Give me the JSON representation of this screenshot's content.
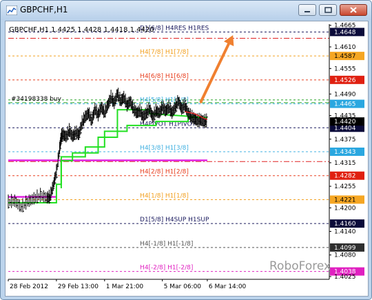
{
  "window": {
    "title": "GBPCHF,H1"
  },
  "chart_data": {
    "type": "line",
    "title": "",
    "info_text": "GBPCHF,H1  1.4425 1.4428 1.4418 1.4420",
    "symbol": "GBPCHF",
    "timeframe": "H1",
    "ohlc": {
      "open": 1.4425,
      "high": 1.4428,
      "low": 1.4418,
      "close": 1.442
    },
    "watermark": "RoboForex",
    "xlabel": "",
    "ylabel": "",
    "ylim": [
      1.4018,
      1.4668
    ],
    "y_ticks": [
      "1.4665",
      "1.4610",
      "1.4555",
      "1.4490",
      "1.4435",
      "1.4375",
      "1.4315",
      "1.4255",
      "1.4200",
      "1.4140",
      "1.4080",
      "1.4025"
    ],
    "x_ticks": [
      "28 Feb 2012",
      "29 Feb 13:00",
      "1 Mar 21:00",
      "5 Mar 06:00",
      "6 Mar 14:00"
    ],
    "current_price": 1.442,
    "levels": [
      {
        "label": "D1[6/8] H4RES H1RES",
        "price": 1.4648,
        "tag": "1.4648",
        "color": "#1a1a5e",
        "style": "dashed",
        "tag_bg": "#0b0b3a",
        "tag_fg": "#ffffff"
      },
      {
        "label": "",
        "price": 1.4632,
        "tag": "",
        "color": "#e02020",
        "style": "dashdot"
      },
      {
        "label": "H4[7/8] H1[7/8]",
        "price": 1.4587,
        "tag": "1.4587",
        "color": "#f2a020",
        "style": "dashed",
        "tag_bg": "#f5a623",
        "tag_fg": "#000000"
      },
      {
        "label": "H4[6/8] H1[6/8]",
        "price": 1.4526,
        "tag": "1.4526",
        "color": "#e84020",
        "style": "dashed",
        "tag_bg": "#e02010",
        "tag_fg": "#ffffff"
      },
      {
        "label": "",
        "price": 1.4475,
        "tag": "",
        "color": "#20a020",
        "style": "dashed"
      },
      {
        "label": "H4[5/8] H1[5/8]",
        "price": 1.4465,
        "tag": "1.4465",
        "color": "#40b0e0",
        "style": "dashed",
        "tag_bg": "#2aa7e0",
        "tag_fg": "#ffffff"
      },
      {
        "label": "H4PIVOT H1PIVOT",
        "price": 1.4404,
        "tag": "1.4404",
        "color": "#1a1a5e",
        "style": "dashed",
        "tag_bg": "#0b0b3a",
        "tag_fg": "#ffffff"
      },
      {
        "label": "H4[3/8] H1[3/8]",
        "price": 1.4343,
        "tag": "1.4343",
        "color": "#40b0e0",
        "style": "dashed",
        "tag_bg": "#2aa7e0",
        "tag_fg": "#ffffff"
      },
      {
        "label": "",
        "price": 1.4318,
        "tag": "",
        "color": "#e02020",
        "style": "dashdot"
      },
      {
        "label": "H4[2/8] H1[2/8]",
        "price": 1.4282,
        "tag": "1.4282",
        "color": "#e84020",
        "style": "dashed",
        "tag_bg": "#e02010",
        "tag_fg": "#ffffff"
      },
      {
        "label": "H4[1/8] H1[1/8]",
        "price": 1.4221,
        "tag": "1.4221",
        "color": "#f2a020",
        "style": "dashed",
        "tag_bg": "#f5a623",
        "tag_fg": "#000000"
      },
      {
        "label": "D1[5/8] H4SUP H1SUP",
        "price": 1.416,
        "tag": "1.4160",
        "color": "#1a1a5e",
        "style": "dashed",
        "tag_bg": "#0b0b3a",
        "tag_fg": "#ffffff"
      },
      {
        "label": "H4[-1/8] H1[-1/8]",
        "price": 1.4099,
        "tag": "1.4099",
        "color": "#555555",
        "style": "dashed",
        "tag_bg": "#2f2f2f",
        "tag_fg": "#ffffff"
      },
      {
        "label": "H4[-2/8] H1[-2/8]",
        "price": 1.4038,
        "tag": "1.4038",
        "color": "#e020c0",
        "style": "dashed",
        "tag_bg": "#e020c0",
        "tag_fg": "#ffffff"
      }
    ],
    "price_tags": [
      {
        "price": 1.442,
        "tag": "1.4420",
        "tag_bg": "#000000",
        "tag_fg": "#ffffff"
      }
    ],
    "order_line": {
      "label": "#34198338 buy",
      "price": 1.4468,
      "color": "#20a020"
    },
    "magenta_lines": [
      {
        "price": 1.4321,
        "x_start": 0.0,
        "x_end": 0.62
      },
      {
        "price": 1.4228,
        "x_start": 0.0,
        "x_end": 0.15
      }
    ],
    "price_path": [
      [
        0.0,
        1.4213
      ],
      [
        0.02,
        1.4216
      ],
      [
        0.04,
        1.42
      ],
      [
        0.06,
        1.4214
      ],
      [
        0.08,
        1.4222
      ],
      [
        0.1,
        1.423
      ],
      [
        0.12,
        1.4224
      ],
      [
        0.13,
        1.4226
      ],
      [
        0.14,
        1.4255
      ],
      [
        0.15,
        1.429
      ],
      [
        0.16,
        1.435
      ],
      [
        0.165,
        1.438
      ],
      [
        0.17,
        1.4385
      ],
      [
        0.18,
        1.438
      ],
      [
        0.19,
        1.4395
      ],
      [
        0.2,
        1.438
      ],
      [
        0.21,
        1.439
      ],
      [
        0.22,
        1.4385
      ],
      [
        0.23,
        1.4415
      ],
      [
        0.24,
        1.443
      ],
      [
        0.25,
        1.444
      ],
      [
        0.26,
        1.442
      ],
      [
        0.27,
        1.445
      ],
      [
        0.28,
        1.4435
      ],
      [
        0.29,
        1.4455
      ],
      [
        0.3,
        1.444
      ],
      [
        0.31,
        1.446
      ],
      [
        0.32,
        1.448
      ],
      [
        0.33,
        1.4465
      ],
      [
        0.34,
        1.449
      ],
      [
        0.35,
        1.447
      ],
      [
        0.36,
        1.448
      ],
      [
        0.37,
        1.446
      ],
      [
        0.38,
        1.447
      ],
      [
        0.39,
        1.445
      ],
      [
        0.4,
        1.444
      ],
      [
        0.41,
        1.4445
      ],
      [
        0.42,
        1.443
      ],
      [
        0.43,
        1.444
      ],
      [
        0.44,
        1.445
      ],
      [
        0.45,
        1.443
      ],
      [
        0.46,
        1.4445
      ],
      [
        0.47,
        1.444
      ],
      [
        0.48,
        1.4455
      ],
      [
        0.49,
        1.4445
      ],
      [
        0.5,
        1.4455
      ],
      [
        0.51,
        1.444
      ],
      [
        0.52,
        1.4455
      ],
      [
        0.53,
        1.447
      ],
      [
        0.54,
        1.445
      ],
      [
        0.55,
        1.446
      ],
      [
        0.56,
        1.444
      ],
      [
        0.57,
        1.443
      ],
      [
        0.58,
        1.4425
      ],
      [
        0.59,
        1.442
      ],
      [
        0.6,
        1.4422
      ],
      [
        0.61,
        1.4418
      ],
      [
        0.62,
        1.442
      ]
    ],
    "green_band": [
      [
        0.0,
        1.4213
      ],
      [
        0.15,
        1.4213
      ],
      [
        0.15,
        1.426
      ],
      [
        0.165,
        1.426
      ],
      [
        0.165,
        1.433
      ],
      [
        0.24,
        1.433
      ],
      [
        0.24,
        1.4355
      ],
      [
        0.3,
        1.4355
      ],
      [
        0.3,
        1.4395
      ],
      [
        0.37,
        1.4395
      ],
      [
        0.37,
        1.441
      ],
      [
        0.46,
        1.441
      ],
      [
        0.46,
        1.442
      ],
      [
        0.56,
        1.442
      ],
      [
        0.56,
        1.443
      ],
      [
        0.62,
        1.443
      ]
    ],
    "green_band_2": [
      [
        0.165,
        1.425
      ],
      [
        0.165,
        1.432
      ],
      [
        0.2,
        1.432
      ],
      [
        0.2,
        1.434
      ],
      [
        0.28,
        1.434
      ],
      [
        0.28,
        1.438
      ],
      [
        0.34,
        1.438
      ],
      [
        0.34,
        1.445
      ],
      [
        0.44,
        1.445
      ],
      [
        0.44,
        1.444
      ],
      [
        0.62,
        1.443
      ]
    ],
    "red_segment": [
      [
        0.55,
        1.4445
      ],
      [
        0.58,
        1.444
      ],
      [
        0.61,
        1.4428
      ],
      [
        0.62,
        1.4425
      ]
    ],
    "arrow": {
      "from": [
        0.6,
        1.447
      ],
      "to": [
        0.7,
        1.464
      ],
      "color": "#f08030"
    }
  }
}
